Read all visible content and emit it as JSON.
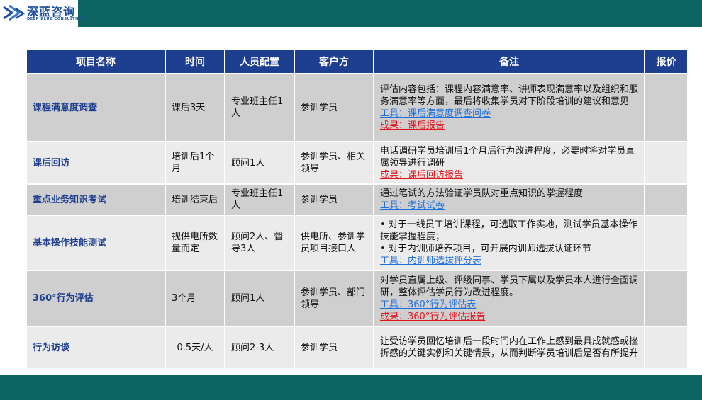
{
  "logo": {
    "name_cn": "深蓝咨询",
    "name_en": "DEEP BLUE CONSULTING"
  },
  "colors": {
    "brand_teal": "#0e6462",
    "header_blue": "#1e3f8f",
    "row_dark": "#cfcfcf",
    "row_light": "#ebebeb",
    "link_blue": "#1e6fdc",
    "result_red": "#e0161c"
  },
  "table": {
    "headers": [
      "项目名称",
      "时间",
      "人员配置",
      "客户方",
      "备注",
      "报价"
    ],
    "rows": [
      {
        "name": "课程满意度调查",
        "time": "课后3天",
        "staff": "专业班主任1人",
        "client": "参训学员",
        "notes": [
          "评估内容包括：课程内容满意率、讲师表现满意率以及组织和服务满意率等方面，最后将收集学员对下阶段培训的建议和意见"
        ],
        "tool": "工具：课后满意度调查问卷",
        "result": "成果：课后报告",
        "price": ""
      },
      {
        "name": "课后回访",
        "time": "培训后1个月",
        "staff": "顾问1人",
        "client": "参训学员、相关领导",
        "notes": [
          "电话调研学员培训后1个月后行为改进程度，必要时将对学员直属领导进行调研"
        ],
        "tool": "",
        "result": "成果：课后回访报告",
        "price": ""
      },
      {
        "name": "重点业务知识考试",
        "time": "培训结束后",
        "staff": "专业班主任1人",
        "client": "参训学员",
        "notes": [
          "通过笔试的方法验证学员队对重点知识的掌握程度"
        ],
        "tool": "工具：考试试卷",
        "result": "",
        "price": ""
      },
      {
        "name": "基本操作技能测试",
        "time": "视供电所数量而定",
        "staff": "顾问2人、督导3人",
        "client": "供电所、参训学员项目接口人",
        "notes": [
          "• 对于一线员工培训课程，可选取工作实地，测试学员基本操作技能掌握程度；",
          "• 对于内训师培养项目，可开展内训师选拔认证环节"
        ],
        "tool": "工具：内训师选拔评分表",
        "result": "",
        "price": ""
      },
      {
        "name": "360°行为评估",
        "time": "3个月",
        "staff": "顾问1人",
        "client": "参训学员、部门领导",
        "notes": [
          "对学员直属上级、评级同事、学员下属以及学员本人进行全面调研，整体评估学员行为改进程度。"
        ],
        "tool": "工具：360°行为评估表",
        "result": "成果：360°行为评估报告",
        "price": ""
      },
      {
        "name": "行为访谈",
        "time": "0.5天/人",
        "staff": "顾问2-3人",
        "client": "参训学员",
        "notes": [
          "让受访学员回忆培训后一段时间内在工作上感到最具成就感或挫折感的关键实例和关键情景，从而判断学员培训后是否有所提升"
        ],
        "tool": "",
        "result": "",
        "price": ""
      }
    ]
  }
}
